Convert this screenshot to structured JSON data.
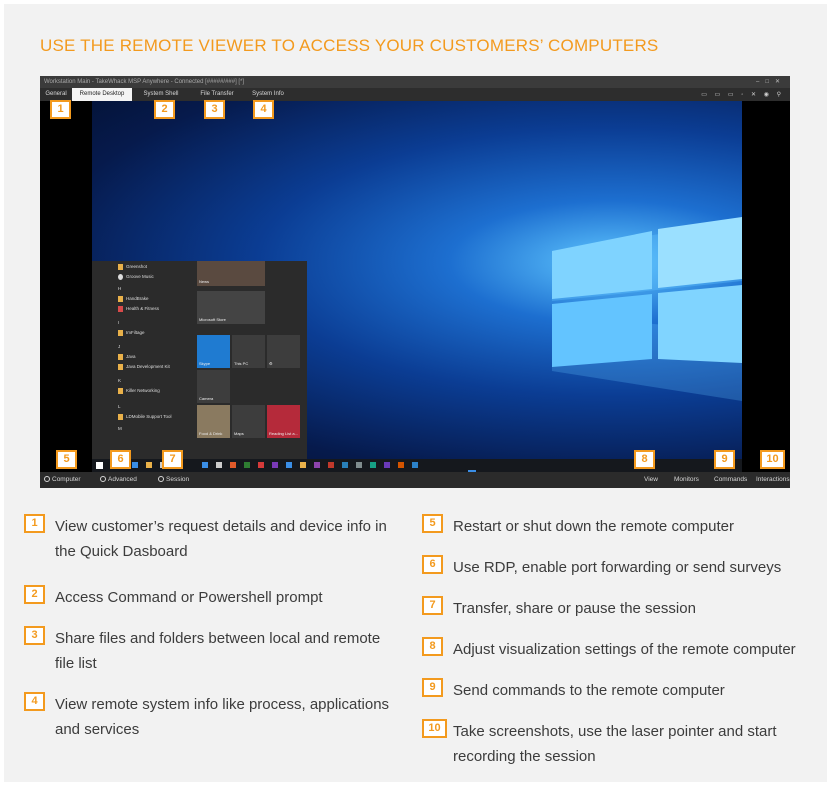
{
  "heading": "USE THE REMOTE VIEWER TO ACCESS YOUR CUSTOMERS’ COMPUTERS",
  "window": {
    "title": "Workstation Main - TakeWhack MSP Anywhere - Connected [#####/###] [*]",
    "tabs": [
      {
        "label": "General"
      },
      {
        "label": "Remote Desktop"
      },
      {
        "label": "System Shell"
      },
      {
        "label": "File Transfer"
      },
      {
        "label": "System Info"
      }
    ],
    "bottom_left": [
      {
        "label": "Computer",
        "icon": "power-icon"
      },
      {
        "label": "Advanced",
        "icon": "gear-icon"
      },
      {
        "label": "Session",
        "icon": "session-icon"
      }
    ],
    "bottom_right": [
      {
        "label": "View"
      },
      {
        "label": "Monitors"
      },
      {
        "label": "Commands"
      },
      {
        "label": "Interactions"
      }
    ]
  },
  "start_menu": {
    "items": [
      "Greenshot",
      "Groove Music",
      "H",
      "HandBrake",
      "Health & Fitness",
      "I",
      "ImFiltage",
      "J",
      "Java",
      "Java Development Kit",
      "K",
      "Killer Networking",
      "L",
      "LDMobile Support Tool",
      "M"
    ],
    "tiles": [
      "News",
      "Microsoft Store",
      "Skype",
      "This PC",
      "Camera",
      "Food & Drink",
      "Maps",
      "Reading List a..."
    ]
  },
  "badges": [
    "1",
    "2",
    "3",
    "4",
    "5",
    "6",
    "7",
    "8",
    "9",
    "10"
  ],
  "legend_left": [
    {
      "num": "1",
      "line1": "View customer’s request details and device info in",
      "line2": "the Quick Dasboard"
    },
    {
      "num": "2",
      "line1": "Access Command or Powershell prompt",
      "line2": ""
    },
    {
      "num": "3",
      "line1": "Share files and folders between local and remote",
      "line2": "file list"
    },
    {
      "num": "4",
      "line1": "View remote system info like process, applications",
      "line2": "and services"
    }
  ],
  "legend_right": [
    {
      "num": "5",
      "line1": "Restart or shut down the remote computer",
      "line2": ""
    },
    {
      "num": "6",
      "line1": "Use RDP, enable port forwarding or send surveys",
      "line2": ""
    },
    {
      "num": "7",
      "line1": "Transfer, share or pause the session",
      "line2": ""
    },
    {
      "num": "8",
      "line1": "Adjust visualization settings of the remote computer",
      "line2": ""
    },
    {
      "num": "9",
      "line1": "Send commands to the remote computer",
      "line2": ""
    },
    {
      "num": "10",
      "line1": "Take screenshots, use the laser pointer and start",
      "line2": "recording the session"
    }
  ],
  "colors": {
    "accent": "#f39a1e",
    "background": "#f2f2f2",
    "text": "#3c3c3c"
  }
}
